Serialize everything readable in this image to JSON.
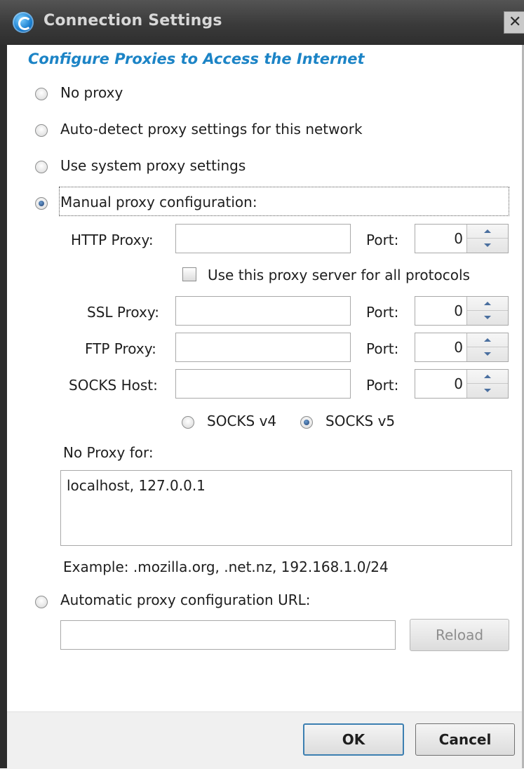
{
  "window": {
    "title": "Connection Settings",
    "close_glyph": "✕"
  },
  "heading": "Configure Proxies to Access the Internet",
  "options": {
    "no_proxy": "No proxy",
    "auto_detect": "Auto-detect proxy settings for this network",
    "system": "Use system proxy settings",
    "manual": "Manual proxy configuration:",
    "auto_url": "Automatic proxy configuration URL:"
  },
  "selected_option": "manual",
  "manual": {
    "http_label": "HTTP Proxy:",
    "http_value": "",
    "http_port": "0",
    "use_all_label": "Use this proxy server for all protocols",
    "use_all_checked": false,
    "ssl_label": "SSL Proxy:",
    "ssl_value": "",
    "ssl_port": "0",
    "ftp_label": "FTP Proxy:",
    "ftp_value": "",
    "ftp_port": "0",
    "socks_label": "SOCKS Host:",
    "socks_value": "",
    "socks_port": "0",
    "port_label": "Port:",
    "socks_v4": "SOCKS v4",
    "socks_v5": "SOCKS v5",
    "socks_selected": "v5"
  },
  "no_proxy_for": {
    "label": "No Proxy for:",
    "value": "localhost, 127.0.0.1",
    "example": "Example: .mozilla.org, .net.nz, 192.168.1.0/24"
  },
  "auto_url_value": "",
  "buttons": {
    "reload": "Reload",
    "ok": "OK",
    "cancel": "Cancel"
  },
  "icons": {
    "app": "seamonkey-globe-icon",
    "close": "close-icon"
  },
  "colors": {
    "heading": "#1c84c6",
    "titlebar": "#3a3a3a",
    "footer": "#f0f0f0"
  }
}
